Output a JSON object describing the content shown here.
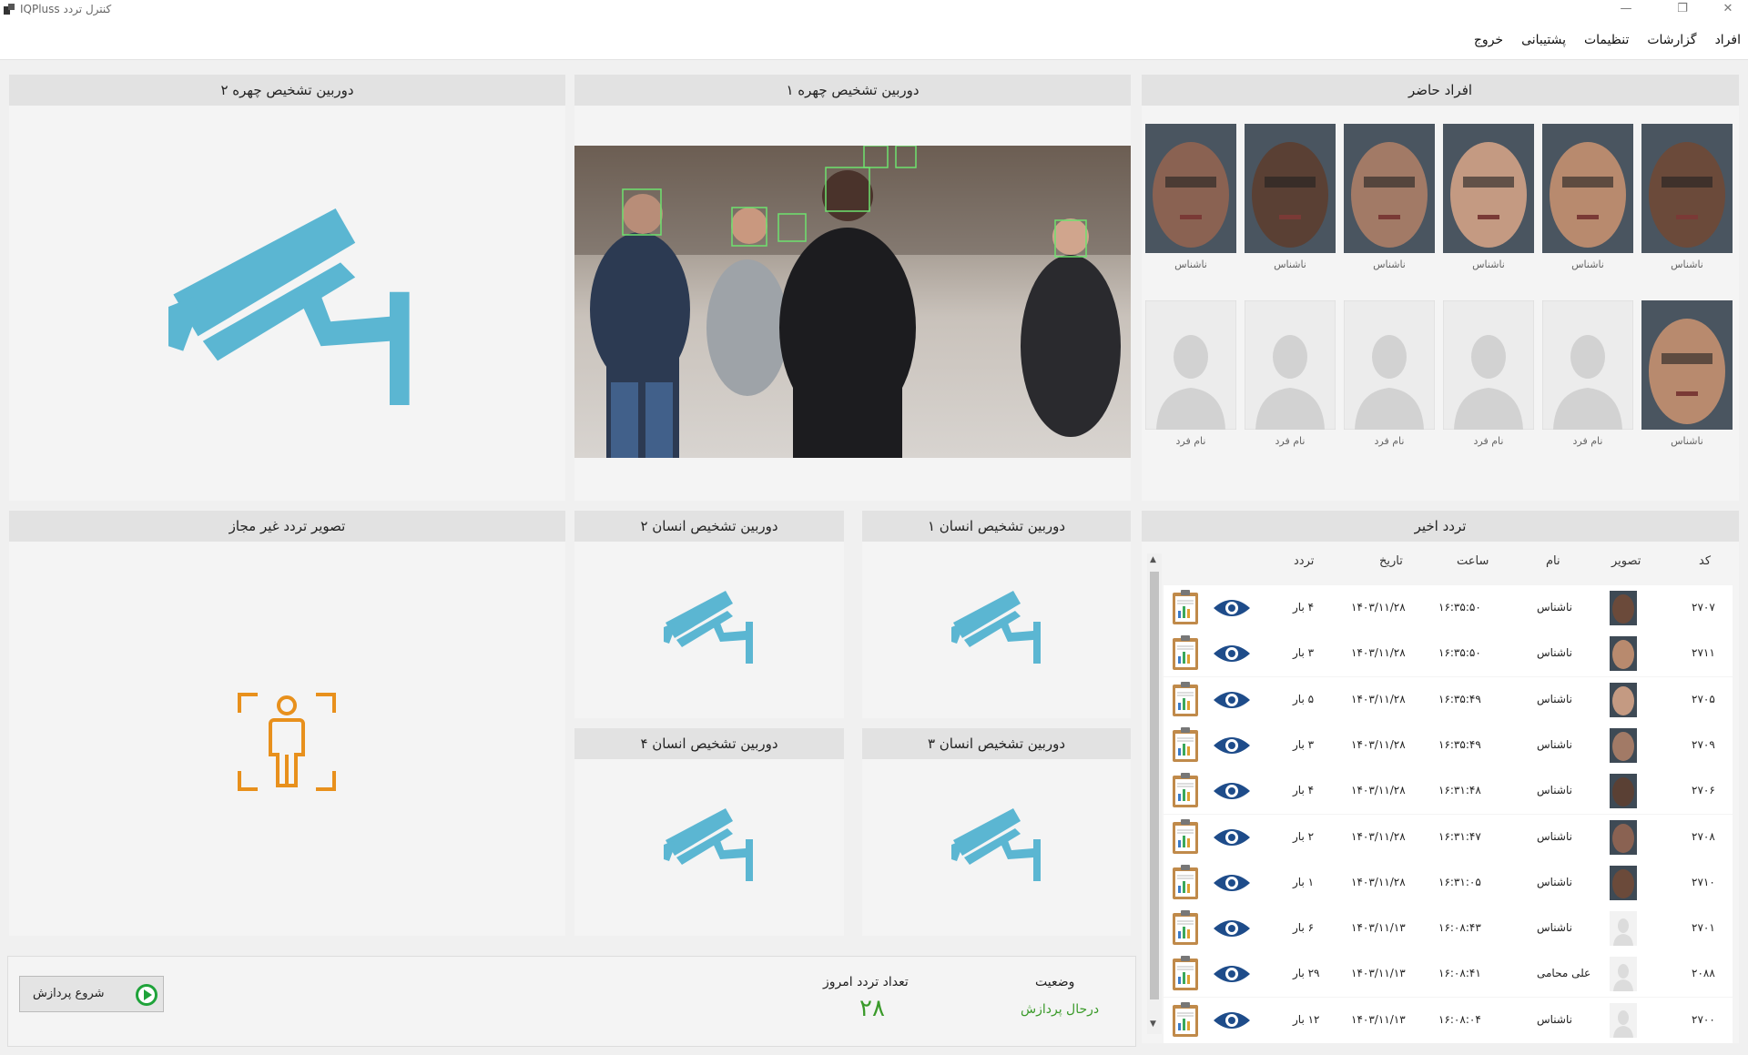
{
  "window": {
    "title": "کنترل تردد IQPluss"
  },
  "menu": [
    "افراد",
    "گزارشات",
    "تنظیمات",
    "پشتیبانی",
    "خروج"
  ],
  "panels": {
    "present_people": "افراد حاضر",
    "face_camera_1": "دوربین  تشخیص چهره ۱",
    "face_camera_2": "دوربین  تشخیص چهره ۲",
    "human_camera_1": "دوربین تشخیص انسان ۱",
    "human_camera_2": "دوربین تشخیص انسان ۲",
    "human_camera_3": "دوربین تشخیص انسان ۳",
    "human_camera_4": "دوربین تشخیص انسان ۴",
    "unauthorized": "تصویر تردد غیر مجاز",
    "recent_traffic": "تردد اخیر"
  },
  "present_faces": {
    "row1": [
      "ناشناس",
      "ناشناس",
      "ناشناس",
      "ناشناس",
      "ناشناس",
      "ناشناس"
    ],
    "row2": [
      "ناشناس",
      "نام فرد",
      "نام فرد",
      "نام فرد",
      "نام فرد",
      "نام فرد"
    ]
  },
  "table": {
    "headers": {
      "code": "کد",
      "image": "تصویر",
      "name": "نام",
      "time": "ساعت",
      "date": "تاریخ",
      "count": "تردد"
    },
    "rows": [
      {
        "code": "۲۷۰۷",
        "name": "ناشناس",
        "time": "۱۶:۳۵:۵۰",
        "date": "۱۴۰۳/۱۱/۲۸",
        "count": "۴ بار"
      },
      {
        "code": "۲۷۱۱",
        "name": "ناشناس",
        "time": "۱۶:۳۵:۵۰",
        "date": "۱۴۰۳/۱۱/۲۸",
        "count": "۳ بار"
      },
      {
        "code": "۲۷۰۵",
        "name": "ناشناس",
        "time": "۱۶:۳۵:۴۹",
        "date": "۱۴۰۳/۱۱/۲۸",
        "count": "۵ بار"
      },
      {
        "code": "۲۷۰۹",
        "name": "ناشناس",
        "time": "۱۶:۳۵:۴۹",
        "date": "۱۴۰۳/۱۱/۲۸",
        "count": "۳ بار"
      },
      {
        "code": "۲۷۰۶",
        "name": "ناشناس",
        "time": "۱۶:۳۱:۴۸",
        "date": "۱۴۰۳/۱۱/۲۸",
        "count": "۴ بار"
      },
      {
        "code": "۲۷۰۸",
        "name": "ناشناس",
        "time": "۱۶:۳۱:۴۷",
        "date": "۱۴۰۳/۱۱/۲۸",
        "count": "۲ بار"
      },
      {
        "code": "۲۷۱۰",
        "name": "ناشناس",
        "time": "۱۶:۳۱:۰۵",
        "date": "۱۴۰۳/۱۱/۲۸",
        "count": "۱ بار"
      },
      {
        "code": "۲۷۰۱",
        "name": "ناشناس",
        "time": "۱۶:۰۸:۴۳",
        "date": "۱۴۰۳/۱۱/۱۳",
        "count": "۶ بار"
      },
      {
        "code": "۲۰۸۸",
        "name": "علی محامی",
        "time": "۱۶:۰۸:۴۱",
        "date": "۱۴۰۳/۱۱/۱۳",
        "count": "۲۹ بار"
      },
      {
        "code": "۲۷۰۰",
        "name": "ناشناس",
        "time": "۱۶:۰۸:۰۴",
        "date": "۱۴۰۳/۱۱/۱۳",
        "count": "۱۲ بار"
      }
    ]
  },
  "status": {
    "start_button": "شروع پردازش",
    "today_label": "تعداد تردد امروز",
    "today_count": "۲۸",
    "status_label": "وضعیت",
    "status_value": "درحال پردازش"
  },
  "colors": {
    "camera_icon": "#5bb6d2",
    "person_icon": "#e8901c",
    "green": "#3a9a2a"
  }
}
